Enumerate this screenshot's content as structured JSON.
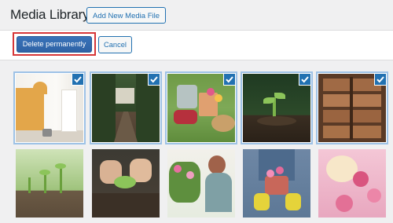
{
  "header": {
    "title": "Media Library",
    "add_new_label": "Add New Media File"
  },
  "toolbar": {
    "delete_label": "Delete permanently",
    "cancel_label": "Cancel"
  },
  "icons": {
    "selected_check": "checkmark-icon"
  },
  "colors": {
    "accent": "#2271b1",
    "highlight_outline": "#d63638",
    "page_background": "#f0f0f1"
  },
  "media_items": [
    {
      "selected": true
    },
    {
      "selected": true
    },
    {
      "selected": true
    },
    {
      "selected": true
    },
    {
      "selected": true
    },
    {
      "selected": false
    },
    {
      "selected": false
    },
    {
      "selected": false
    },
    {
      "selected": false
    },
    {
      "selected": false
    }
  ]
}
